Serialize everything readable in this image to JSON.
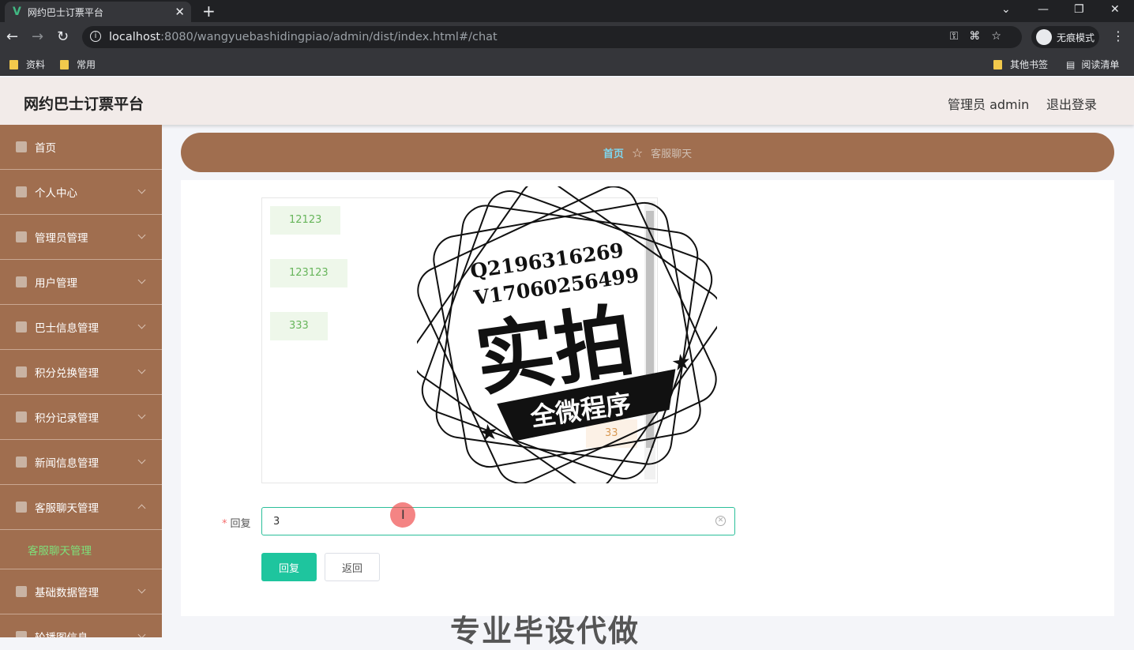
{
  "browser": {
    "tab_title": "网约巴士订票平台",
    "url_host": "localhost",
    "url_path": ":8080/wangyuebashidingpiao/admin/dist/index.html#/chat",
    "incognito_label": "无痕模式",
    "bookmarks": [
      "资料",
      "常用"
    ],
    "bookmarks_right": [
      "其他书签",
      "阅读清单"
    ]
  },
  "header": {
    "title": "网约巴士订票平台",
    "user": "管理员 admin",
    "logout": "退出登录"
  },
  "sidebar": {
    "items": [
      {
        "label": "首页"
      },
      {
        "label": "个人中心"
      },
      {
        "label": "管理员管理"
      },
      {
        "label": "用户管理"
      },
      {
        "label": "巴士信息管理"
      },
      {
        "label": "积分兑换管理"
      },
      {
        "label": "积分记录管理"
      },
      {
        "label": "新闻信息管理"
      },
      {
        "label": "客服聊天管理"
      },
      {
        "label": "客服聊天管理"
      },
      {
        "label": "基础数据管理"
      },
      {
        "label": "轮播图信息"
      }
    ]
  },
  "breadcrumb": {
    "home": "首页",
    "current": "客服聊天"
  },
  "chat": {
    "messages": [
      "12123",
      "123123",
      "333",
      "33"
    ]
  },
  "form": {
    "reply_label": "回复",
    "reply_value": "3",
    "reply_button": "回复",
    "back_button": "返回"
  },
  "watermark": {
    "line1": "Q2196316269",
    "line2": "V17060256499",
    "big": "实拍",
    "banner": "全微程序",
    "bottom": "专业毕设代做"
  }
}
